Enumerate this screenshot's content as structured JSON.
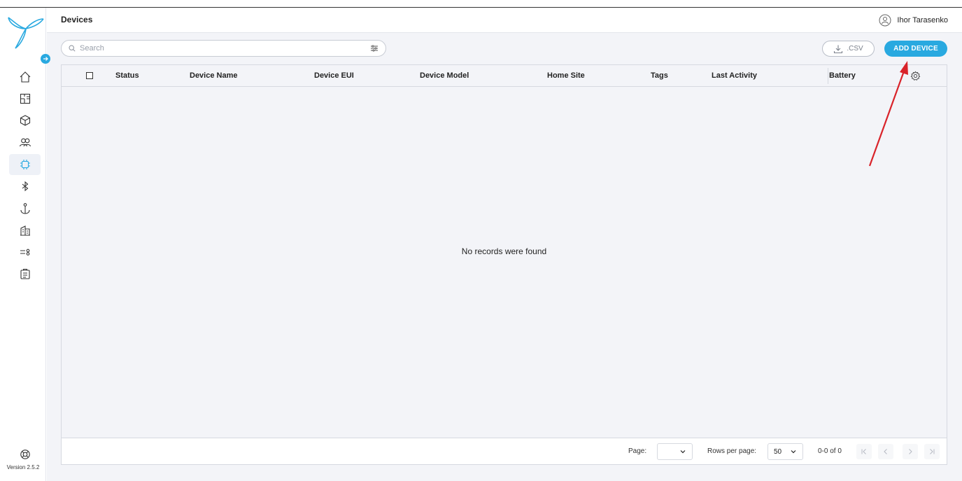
{
  "app": {
    "version": "Version 2.5.2"
  },
  "header": {
    "title": "Devices",
    "user_name": "Ihor Tarasenko"
  },
  "sidebar": {
    "items": [
      {
        "name": "home-icon",
        "active": false
      },
      {
        "name": "floorplan-icon",
        "active": false
      },
      {
        "name": "cube-icon",
        "active": false
      },
      {
        "name": "users-icon",
        "active": false
      },
      {
        "name": "chip-icon",
        "active": true
      },
      {
        "name": "bluetooth-icon",
        "active": false
      },
      {
        "name": "anchor-icon",
        "active": false
      },
      {
        "name": "building-icon",
        "active": false
      },
      {
        "name": "rules-icon",
        "active": false
      },
      {
        "name": "clipboard-icon",
        "active": false
      }
    ]
  },
  "toolbar": {
    "search_placeholder": "Search",
    "csv_label": ".CSV",
    "add_label": "ADD DEVICE"
  },
  "table": {
    "columns": [
      "Status",
      "Device Name",
      "Device EUI",
      "Device Model",
      "Home Site",
      "Tags",
      "Last Activity",
      "Battery"
    ],
    "rows": [],
    "empty_message": "No records were found"
  },
  "pagination": {
    "page_label": "Page:",
    "page_value": "",
    "rows_label": "Rows per page:",
    "rows_value": "50",
    "range": "0-0 of 0"
  },
  "colors": {
    "accent": "#29a9e0",
    "annotation_arrow": "#d9232a"
  }
}
